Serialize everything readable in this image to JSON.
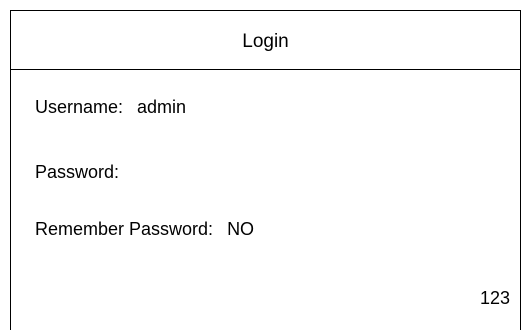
{
  "header": {
    "title": "Login"
  },
  "form": {
    "username": {
      "label": "Username:",
      "value": "admin"
    },
    "password": {
      "label": "Password:",
      "value": ""
    },
    "remember_password": {
      "label": "Remember Password:",
      "value": "NO"
    }
  },
  "footer": {
    "page_number": "123"
  },
  "colors": {
    "background": "#ffffff",
    "border": "#000000",
    "text": "#000000"
  }
}
